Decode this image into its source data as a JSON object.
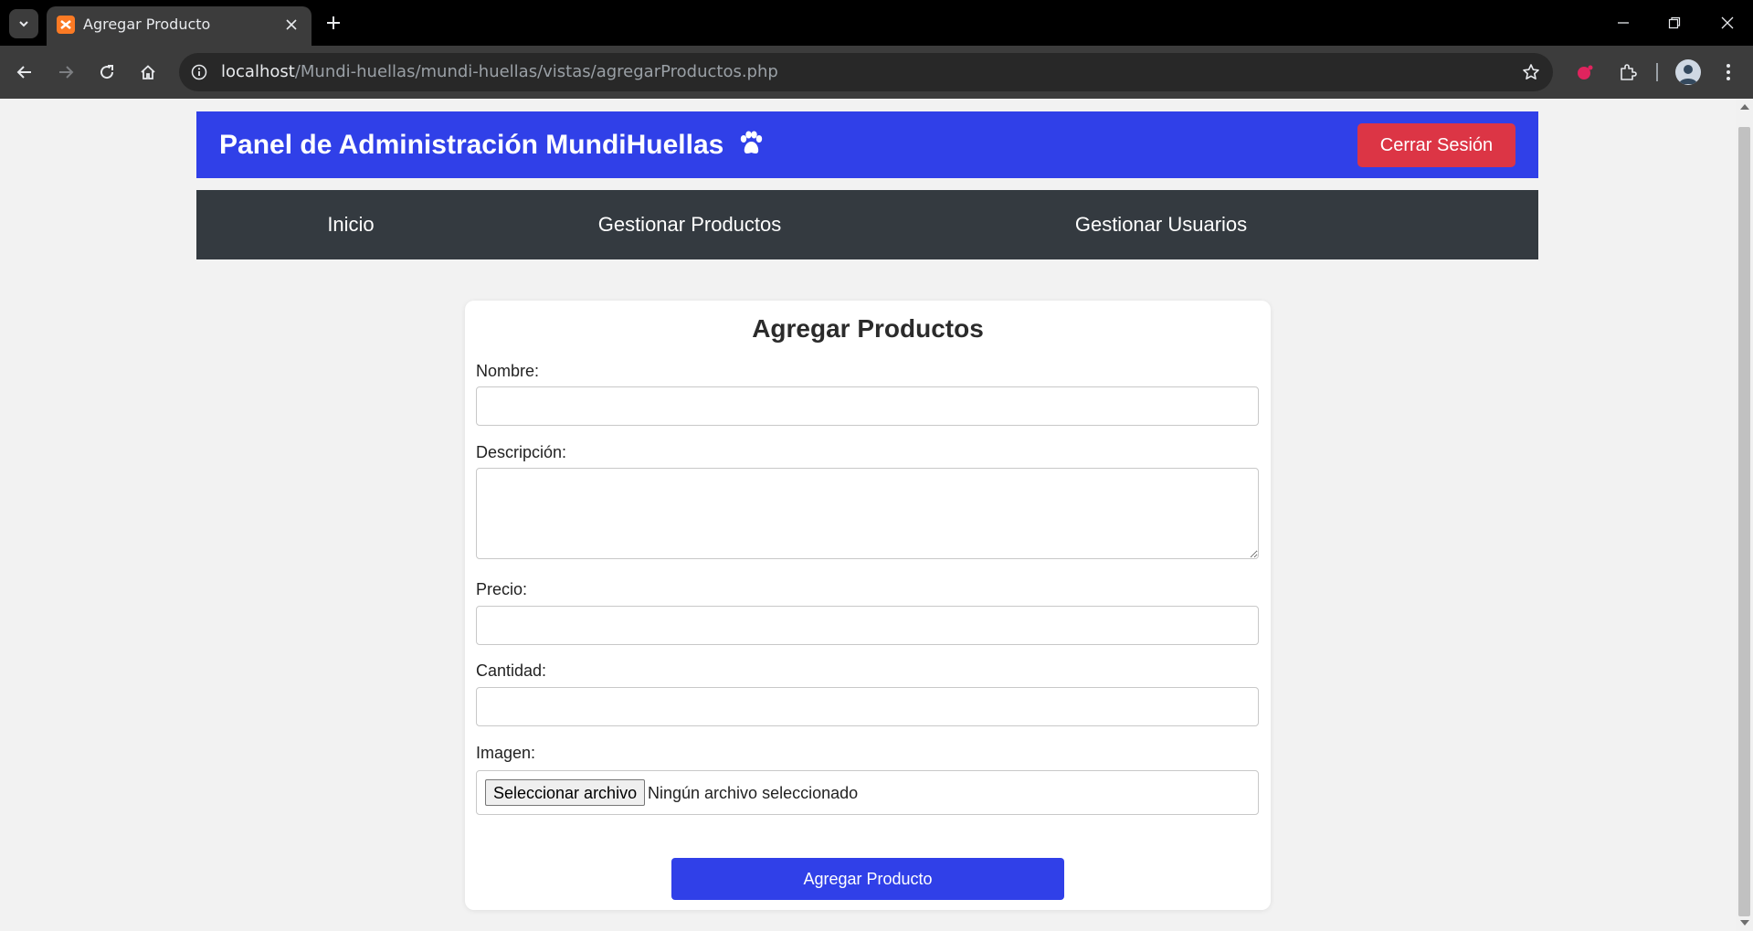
{
  "browser": {
    "tab_title": "Agregar Producto",
    "url_host": "localhost",
    "url_path": "/Mundi-huellas/mundi-huellas/vistas/agregarProductos.php"
  },
  "header": {
    "title": "Panel de Administración MundiHuellas",
    "logout_label": "Cerrar Sesión",
    "accent_color": "#3040e8",
    "logout_color": "#dc3545"
  },
  "nav": {
    "items": [
      {
        "label": "Inicio"
      },
      {
        "label": "Gestionar Productos"
      },
      {
        "label": "Gestionar Usuarios"
      }
    ]
  },
  "form": {
    "title": "Agregar Productos",
    "nombre_label": "Nombre:",
    "nombre_value": "",
    "descripcion_label": "Descripción:",
    "descripcion_value": "",
    "precio_label": "Precio:",
    "precio_value": "",
    "cantidad_label": "Cantidad:",
    "cantidad_value": "",
    "imagen_label": "Imagen:",
    "file_button_label": "Seleccionar archivo",
    "file_status": "Ningún archivo seleccionado",
    "submit_label": "Agregar Producto"
  }
}
